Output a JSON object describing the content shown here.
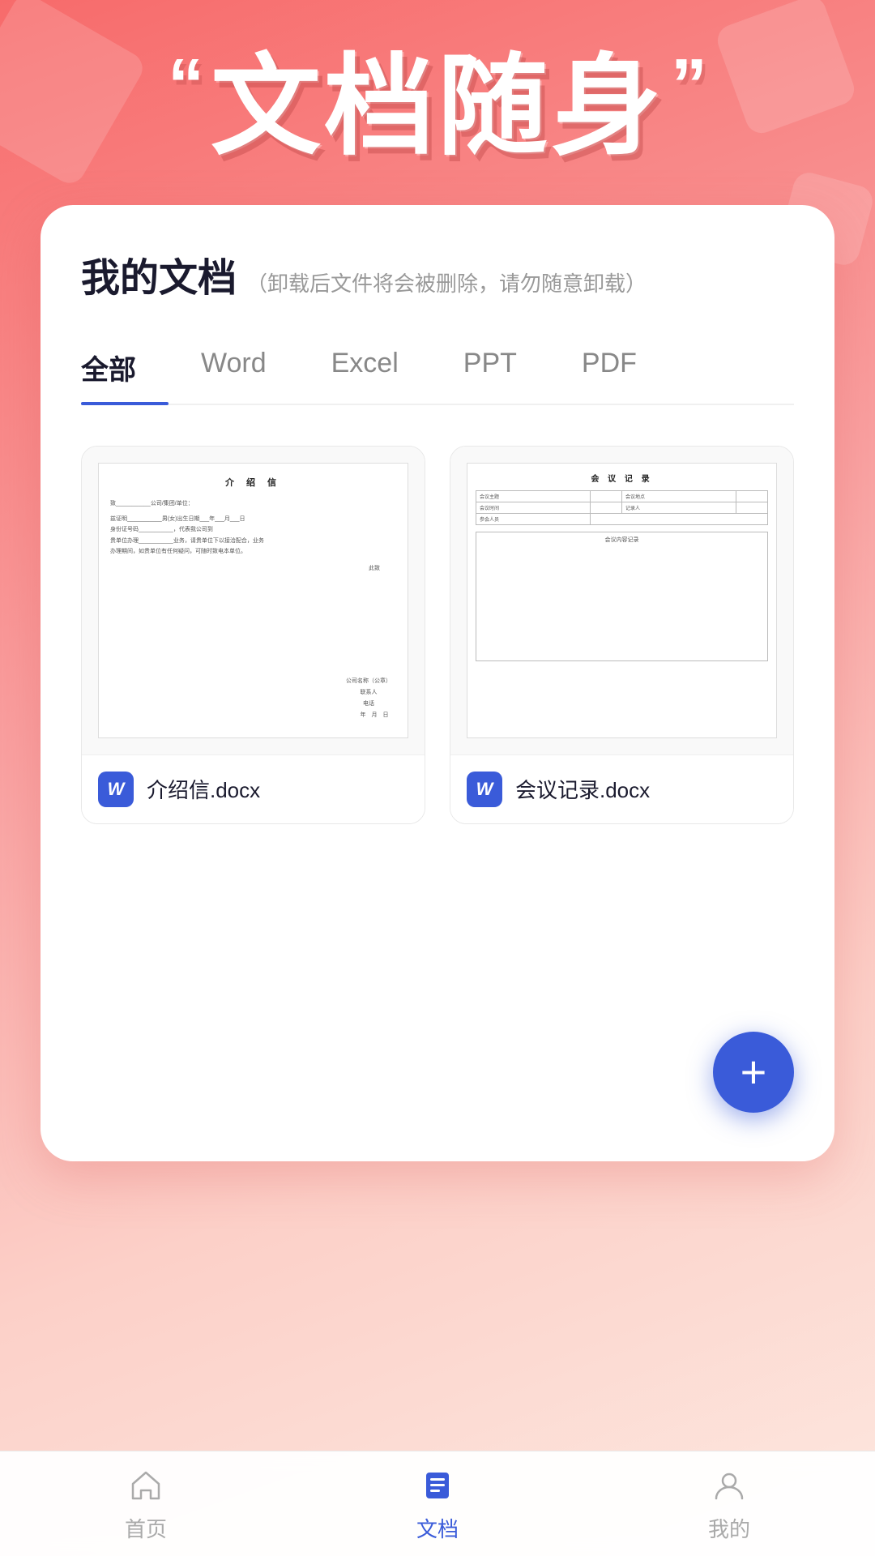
{
  "hero": {
    "quote_left": "“",
    "quote_right": "”",
    "title": "文档随身"
  },
  "card": {
    "title": "我的文档",
    "subtitle": "（卸载后文件将会被删除，请勿随意卸载）"
  },
  "tabs": [
    {
      "id": "all",
      "label": "全部",
      "active": true
    },
    {
      "id": "word",
      "label": "Word",
      "active": false
    },
    {
      "id": "excel",
      "label": "Excel",
      "active": false
    },
    {
      "id": "ppt",
      "label": "PPT",
      "active": false
    },
    {
      "id": "pdf",
      "label": "PDF",
      "active": false
    }
  ],
  "documents": [
    {
      "id": "intro-letter",
      "filename": "介绍信.docx",
      "type": "docx",
      "icon_letter": "W",
      "preview_title": "介 绍 信",
      "preview_lines": [
        "致___________公司/集团/单位：",
        "兹证明___________男(女)出生日期___年___月___日",
        "身份证号码___________，代表我公司到",
        "贵单位办理___________业务，请贵单位下以接洽配合，业务",
        "办理期间，如贵单位有任何疑问，可随时致电本单位。",
        "此致"
      ],
      "sign_lines": [
        "公司名称（公章）",
        "联系人",
        "电话",
        "   年   月   日"
      ]
    },
    {
      "id": "meeting-record",
      "filename": "会议记录.docx",
      "type": "docx",
      "icon_letter": "W",
      "preview_title": "会 议 记 录",
      "table_rows": [
        [
          "会议主题",
          "",
          "会议地点",
          ""
        ],
        [
          "会议时间",
          "",
          "记录人",
          ""
        ],
        [
          "参会人员",
          ""
        ]
      ],
      "content_label": "会议内容记录"
    }
  ],
  "fab": {
    "label": "+"
  },
  "bottom_nav": [
    {
      "id": "home",
      "label": "首页",
      "active": false
    },
    {
      "id": "docs",
      "label": "文档",
      "active": true
    },
    {
      "id": "profile",
      "label": "我的",
      "active": false
    }
  ]
}
